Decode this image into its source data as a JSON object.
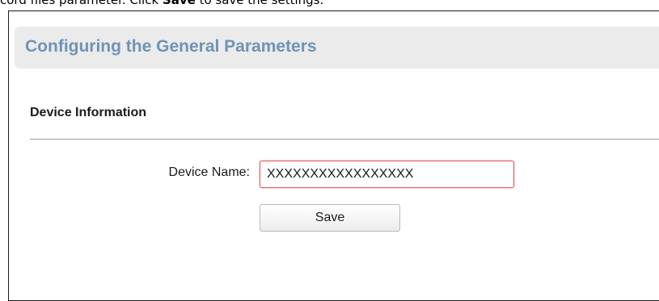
{
  "document": {
    "instruction_prefix": "cord files parameter. Click ",
    "instruction_bold": "Save",
    "instruction_suffix": " to save the settings."
  },
  "panel": {
    "title": "Configuring the General Parameters",
    "section_title": "Device Information",
    "device_name_label": "Device Name:",
    "device_name_value": "XXXXXXXXXXXXXXXXX",
    "save_label": "Save"
  },
  "colors": {
    "title_text": "#6e93b6",
    "title_bar_bg": "#ebebeb",
    "input_border_invalid": "#e05a5a"
  }
}
